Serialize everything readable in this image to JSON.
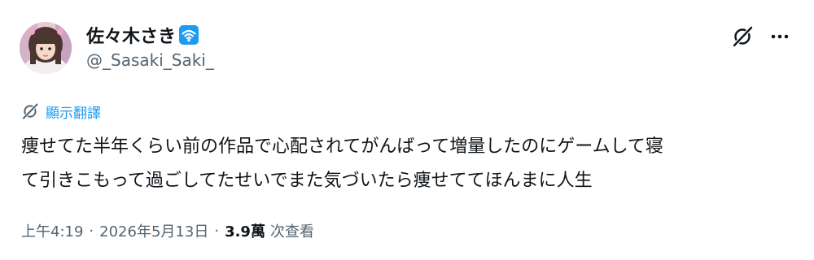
{
  "author": {
    "display_name": "佐々木さき",
    "handle": "@_Sasaki_Saki_",
    "badge_icon": "wifi-badge-icon",
    "badge_color": "#1d9bf0"
  },
  "actions": {
    "grok_icon": "grok-icon",
    "more_icon": "more-icon"
  },
  "translate": {
    "label": "顯示翻譯",
    "icon": "grok-icon",
    "color": "#1d9bf0"
  },
  "post": {
    "lines": [
      "痩せてた半年くらい前の作品で心配されてがんばって増量したのにゲームして寝",
      "て引きこもって過ごしてたせいでまた気づいたら痩せててほんまに人生"
    ]
  },
  "meta": {
    "time": "上午4:19",
    "separator": "·",
    "date": "2026年5月13日",
    "views_count": "3.9萬",
    "views_label": "次查看"
  },
  "colors": {
    "text_primary": "#0f1419",
    "text_secondary": "#536471",
    "accent": "#1d9bf0"
  }
}
